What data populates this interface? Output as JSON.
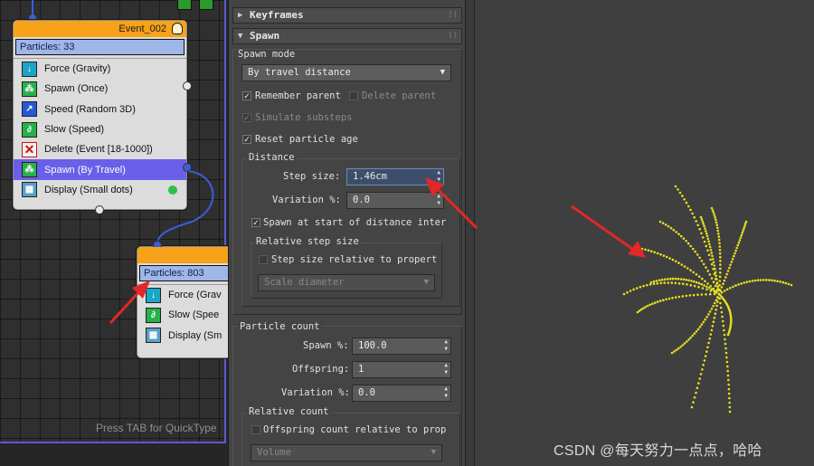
{
  "flow": {
    "event_top": {
      "title": "Event_002",
      "particles": "Particles: 33",
      "operators": [
        {
          "label": "Force (Gravity)",
          "icon": "force-icon",
          "color": "#1aa6c4"
        },
        {
          "label": "Spawn (Once)",
          "icon": "spawn-icon",
          "color": "#28b04a"
        },
        {
          "label": "Speed (Random 3D)",
          "icon": "speed-icon",
          "color": "#2858d8"
        },
        {
          "label": "Slow (Speed)",
          "icon": "slow-icon",
          "color": "#28b04a"
        },
        {
          "label": "Delete (Event [18-1000])",
          "icon": "delete-icon",
          "color": "#d01010"
        },
        {
          "label": "Spawn (By Travel)",
          "icon": "spawn-icon",
          "color": "#28b04a"
        },
        {
          "label": "Display (Small dots)",
          "icon": "display-icon",
          "color": "#5aa0c8"
        }
      ]
    },
    "event_bottom": {
      "particles": "Particles: 803",
      "operators": [
        {
          "label": "Force (Grav",
          "icon": "force-icon"
        },
        {
          "label": "Slow (Spee",
          "icon": "slow-icon"
        },
        {
          "label": "Display (Sm",
          "icon": "display-icon"
        }
      ]
    },
    "hint": "Press TAB for QuickType"
  },
  "rollout": {
    "keyframes_title": "Keyframes",
    "spawn_title": "Spawn",
    "spawn_mode_label": "Spawn mode",
    "spawn_mode_value": "By travel distance",
    "remember_parent": "Remember parent",
    "delete_parent": "Delete parent",
    "simulate_substeps": "Simulate substeps",
    "reset_particle_age": "Reset particle age",
    "distance_label": "Distance",
    "step_size_label": "Step size:",
    "step_size_value": "1.46cm",
    "variation_label": "Variation %:",
    "variation_value": "0.0",
    "spawn_at_start": "Spawn at start of distance inter",
    "relative_step_label": "Relative step size",
    "step_relative": "Step size relative to propert",
    "scale_diameter": "Scale diameter",
    "particle_count_label": "Particle count",
    "spawn_pct_label": "Spawn %:",
    "spawn_pct_value": "100.0",
    "offspring_label": "Offspring:",
    "offspring_value": "1",
    "count_variation_label": "Variation %:",
    "count_variation_value": "0.0",
    "relative_count_label": "Relative count",
    "offspring_relative": "Offspring count relative to prop",
    "volume_label": "Volume"
  },
  "watermark": "CSDN @每天努力一点点，哈哈",
  "colors": {
    "particle": "#e8e020",
    "annotation_arrow": "#e02828",
    "selected": "#6a5fe8",
    "header": "#f7a219"
  }
}
